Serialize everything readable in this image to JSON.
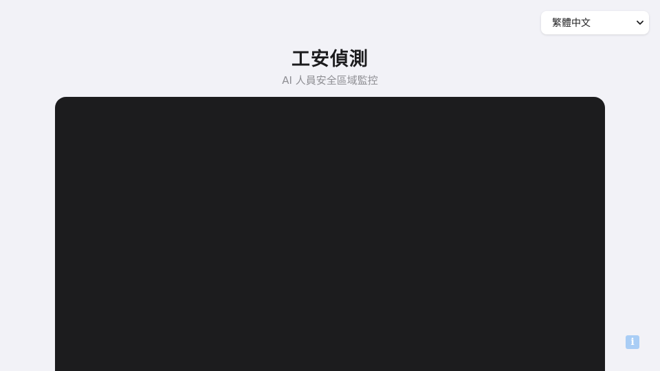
{
  "header": {
    "language_selector": {
      "selected": "繁體中文"
    },
    "title": "工安偵測",
    "subtitle": "AI 人員安全區域監控"
  },
  "info_button": {
    "icon": "info-icon",
    "glyph": "i"
  },
  "colors": {
    "background": "#f2f2f7",
    "panel": "#1c1c1e",
    "title_text": "#1c1c1e",
    "subtitle_text": "#8e8e93",
    "info_accent": "#a9cdf5"
  }
}
